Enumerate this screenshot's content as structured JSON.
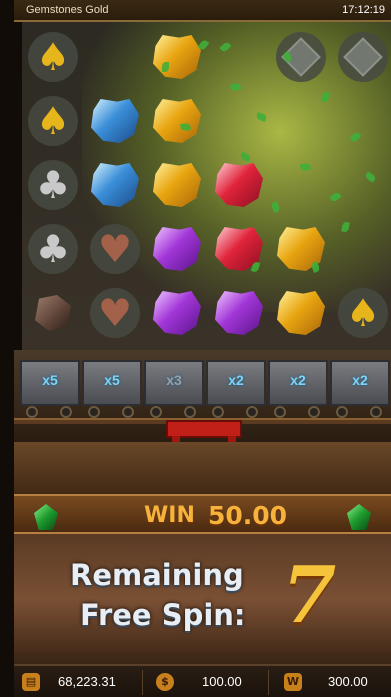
{
  "header": {
    "title": "Gemstones Gold",
    "time": "17:12:19"
  },
  "board": {
    "columns": [
      [
        "spade",
        "spade",
        "club",
        "club",
        "rock"
      ],
      [
        "empty",
        "blue-gem",
        "blue-gem",
        "heart",
        "heart"
      ],
      [
        "gold-gem",
        "gold-gem",
        "gold-gem",
        "purple-gem",
        "purple-gem"
      ],
      [
        "empty",
        "empty",
        "red-gem",
        "red-gem",
        "purple-gem"
      ],
      [
        "diamond",
        "empty",
        "empty",
        "gold-gem",
        "gold-gem"
      ],
      [
        "diamond",
        "empty",
        "empty",
        "empty",
        "spade"
      ]
    ]
  },
  "carts": [
    {
      "label": "x5"
    },
    {
      "label": "x5"
    },
    {
      "label": "x3"
    },
    {
      "label": "x2"
    },
    {
      "label": "x2"
    },
    {
      "label": "x2"
    }
  ],
  "win": {
    "label": "WIN",
    "amount": "50.00"
  },
  "free_spin": {
    "line1": "Remaining",
    "line2": "Free Spin:",
    "count": "7"
  },
  "footer": {
    "balance": "68,223.31",
    "bet": "100.00",
    "win": "300.00"
  }
}
